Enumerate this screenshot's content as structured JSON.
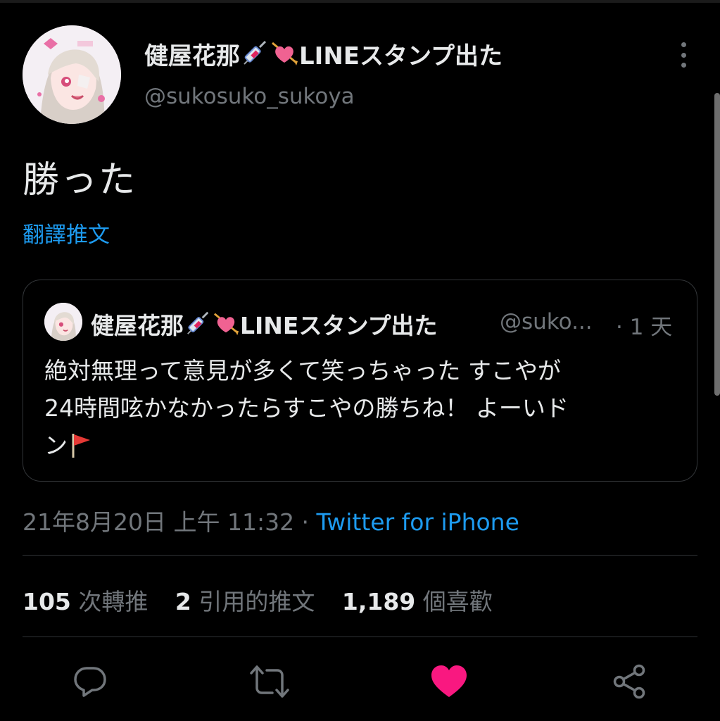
{
  "author": {
    "display_name": "健屋花那",
    "name_suffix": "LINEスタンプ出た",
    "handle": "@sukosuko_sukoya"
  },
  "tweet": {
    "text": "勝った",
    "translate_label": "翻譯推文"
  },
  "quoted_tweet": {
    "display_name": "健屋花那",
    "name_suffix": "LINEスタンプ出た",
    "handle": "@suko...",
    "time": "· 1 天",
    "body_line1": "絶対無理って意見が多くて笑っちゃった すこやが",
    "body_line2": "24時間呟かなかったらすこやの勝ちね！ よーいド",
    "body_line3": "ン"
  },
  "meta": {
    "timestamp": "21年8月20日 上午 11:32",
    "separator": " · ",
    "source": "Twitter for iPhone"
  },
  "stats": {
    "retweets_count": "105",
    "retweets_label": "次轉推",
    "quotes_count": "2",
    "quotes_label": "引用的推文",
    "likes_count": "1,189",
    "likes_label": "個喜歡"
  },
  "icons": {
    "reply": "reply-icon",
    "retweet": "retweet-icon",
    "like": "heart-icon",
    "share": "share-icon",
    "more": "more-vertical-icon",
    "name_emoji_1": "syringe-icon",
    "name_emoji_2": "heart-arrow-icon",
    "flag": "red-flag-icon"
  },
  "colors": {
    "background": "#000000",
    "text": "#e7e9ea",
    "secondary": "#71767b",
    "link": "#1d9bf0",
    "like": "#f91880",
    "border": "#2f3336"
  }
}
